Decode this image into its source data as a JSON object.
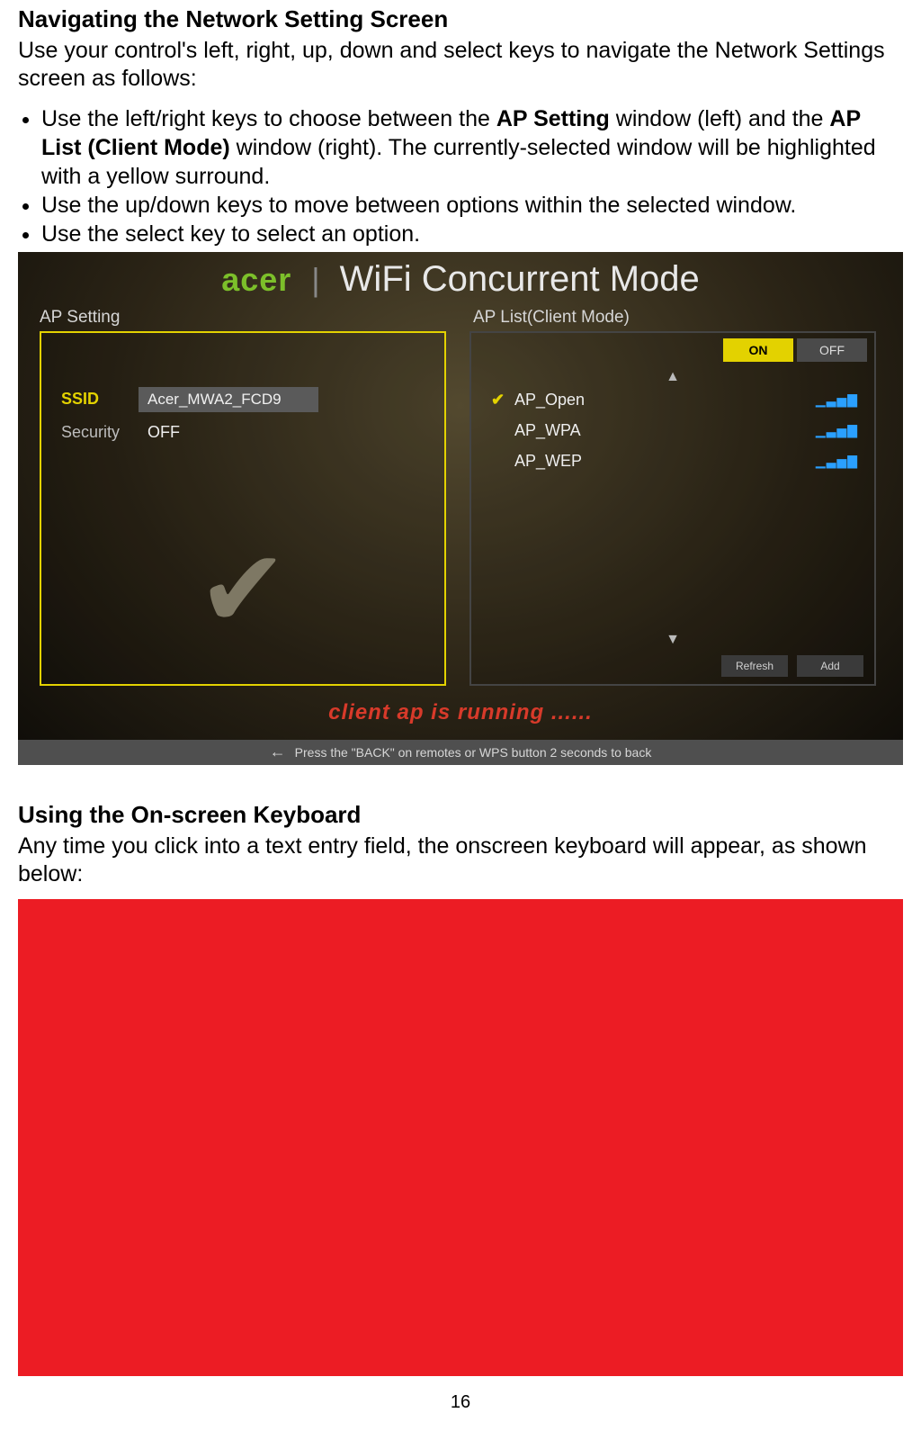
{
  "heading1": "Navigating the Network Setting Screen",
  "intro1": "Use your control's left, right, up, down and select keys to navigate the Network Settings screen as follows:",
  "bullets": {
    "b1_pre": "Use the left/right keys to choose between the ",
    "b1_bold1": "AP Setting",
    "b1_mid": " window (left) and the ",
    "b1_bold2": "AP List (Client Mode)",
    "b1_post": " window (right). The currently-selected window will be highlighted with a yellow surround.",
    "b2": "Use the up/down keys to move between options within the selected window.",
    "b3": "Use the select key to select an option."
  },
  "heading2": "Using the On-screen Keyboard",
  "intro2": "Any time you click into a text entry field, the onscreen keyboard will appear, as shown below:",
  "page_number": "16",
  "screen": {
    "brand": "acer",
    "mode_title": "WiFi Concurrent Mode",
    "left_label": "AP Setting",
    "right_label": "AP List(Client Mode)",
    "ssid_label": "SSID",
    "ssid_value": "Acer_MWA2_FCD9",
    "security_label": "Security",
    "security_value": "OFF",
    "on_label": "ON",
    "off_label": "OFF",
    "ap_list": [
      {
        "name": "AP_Open",
        "selected": true
      },
      {
        "name": "AP_WPA",
        "selected": false
      },
      {
        "name": "AP_WEP",
        "selected": false
      }
    ],
    "refresh": "Refresh",
    "add": "Add",
    "status": "client ap is running ......",
    "footer": "Press the \"BACK\" on remotes or WPS button 2 seconds to back"
  }
}
